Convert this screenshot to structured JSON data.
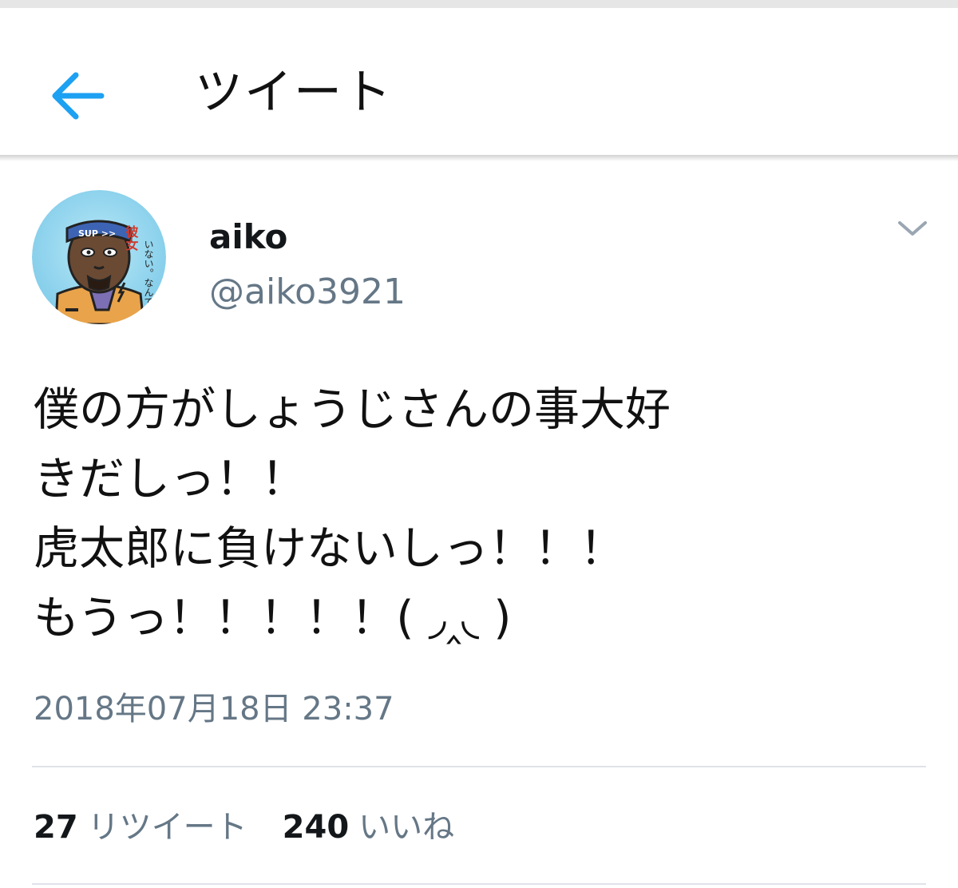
{
  "header": {
    "title": "ツイート",
    "back_icon": "arrow-left-icon",
    "accent_color": "#1da1f2"
  },
  "tweet": {
    "author": {
      "display_name": "aiko",
      "screen_name": "@aiko3921",
      "avatar_text_top": "彼女",
      "avatar_text_side": "いない。なんて",
      "avatar_headband_text": "SUP >>"
    },
    "menu_icon": "chevron-down-icon",
    "text_lines": [
      "僕の方がしょうじさんの事大好",
      "きだしっ！！",
      "虎太郎に負けないしっ！！！",
      "もうっ！！！！！( ◞‸◟ )"
    ],
    "timestamp": "2018年07月18日 23:37",
    "stats": {
      "retweets": {
        "count": "27",
        "label": "リツイート"
      },
      "likes": {
        "count": "240",
        "label": "いいね"
      }
    }
  }
}
